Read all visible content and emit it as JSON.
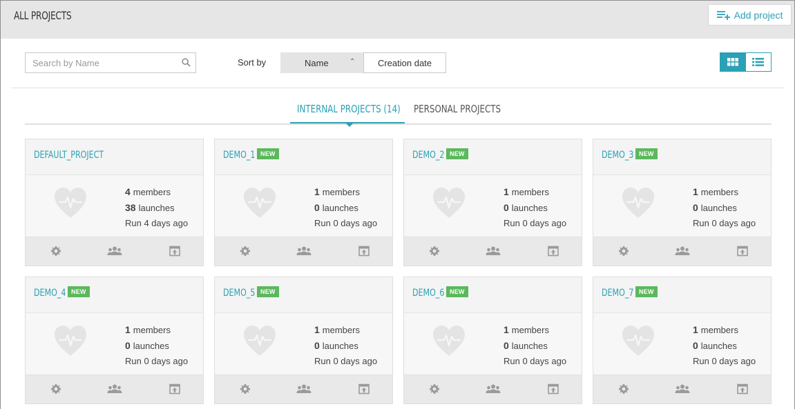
{
  "header": {
    "title": "ALL PROJECTS",
    "add_project_label": "Add project"
  },
  "toolbar": {
    "search_placeholder": "Search by Name",
    "sort_by_label": "Sort by",
    "sort_options": [
      "Name",
      "Creation date"
    ],
    "active_sort": "Name",
    "active_view": "grid"
  },
  "tabs": [
    {
      "label": "INTERNAL PROJECTS (14)",
      "active": true
    },
    {
      "label": "PERSONAL PROJECTS",
      "active": false
    }
  ],
  "labels": {
    "members": "members",
    "launches": "launches",
    "new_badge": "NEW"
  },
  "projects": [
    {
      "name": "DEFAULT_PROJECT",
      "is_new": false,
      "members": "4",
      "launches": "38",
      "last_run": "Run 4 days ago"
    },
    {
      "name": "DEMO_1",
      "is_new": true,
      "members": "1",
      "launches": "0",
      "last_run": "Run 0 days ago"
    },
    {
      "name": "DEMO_2",
      "is_new": true,
      "members": "1",
      "launches": "0",
      "last_run": "Run 0 days ago"
    },
    {
      "name": "DEMO_3",
      "is_new": true,
      "members": "1",
      "launches": "0",
      "last_run": "Run 0 days ago"
    },
    {
      "name": "DEMO_4",
      "is_new": true,
      "members": "1",
      "launches": "0",
      "last_run": "Run 0 days ago"
    },
    {
      "name": "DEMO_5",
      "is_new": true,
      "members": "1",
      "launches": "0",
      "last_run": "Run 0 days ago"
    },
    {
      "name": "DEMO_6",
      "is_new": true,
      "members": "1",
      "launches": "0",
      "last_run": "Run 0 days ago"
    },
    {
      "name": "DEMO_7",
      "is_new": true,
      "members": "1",
      "launches": "0",
      "last_run": "Run 0 days ago"
    }
  ],
  "colors": {
    "accent": "#2aa1b6",
    "new_badge": "#5cb85c",
    "header_bg": "#e6e6e6"
  },
  "icons": {
    "add_project": "add-list-icon",
    "search": "search-icon",
    "sort_arrow": "chevron-up-icon",
    "grid_view": "grid-view-icon",
    "list_view": "list-view-icon",
    "card_placeholder": "heart-pulse-icon",
    "settings": "gear-icon",
    "members": "users-icon",
    "open": "export-icon"
  }
}
